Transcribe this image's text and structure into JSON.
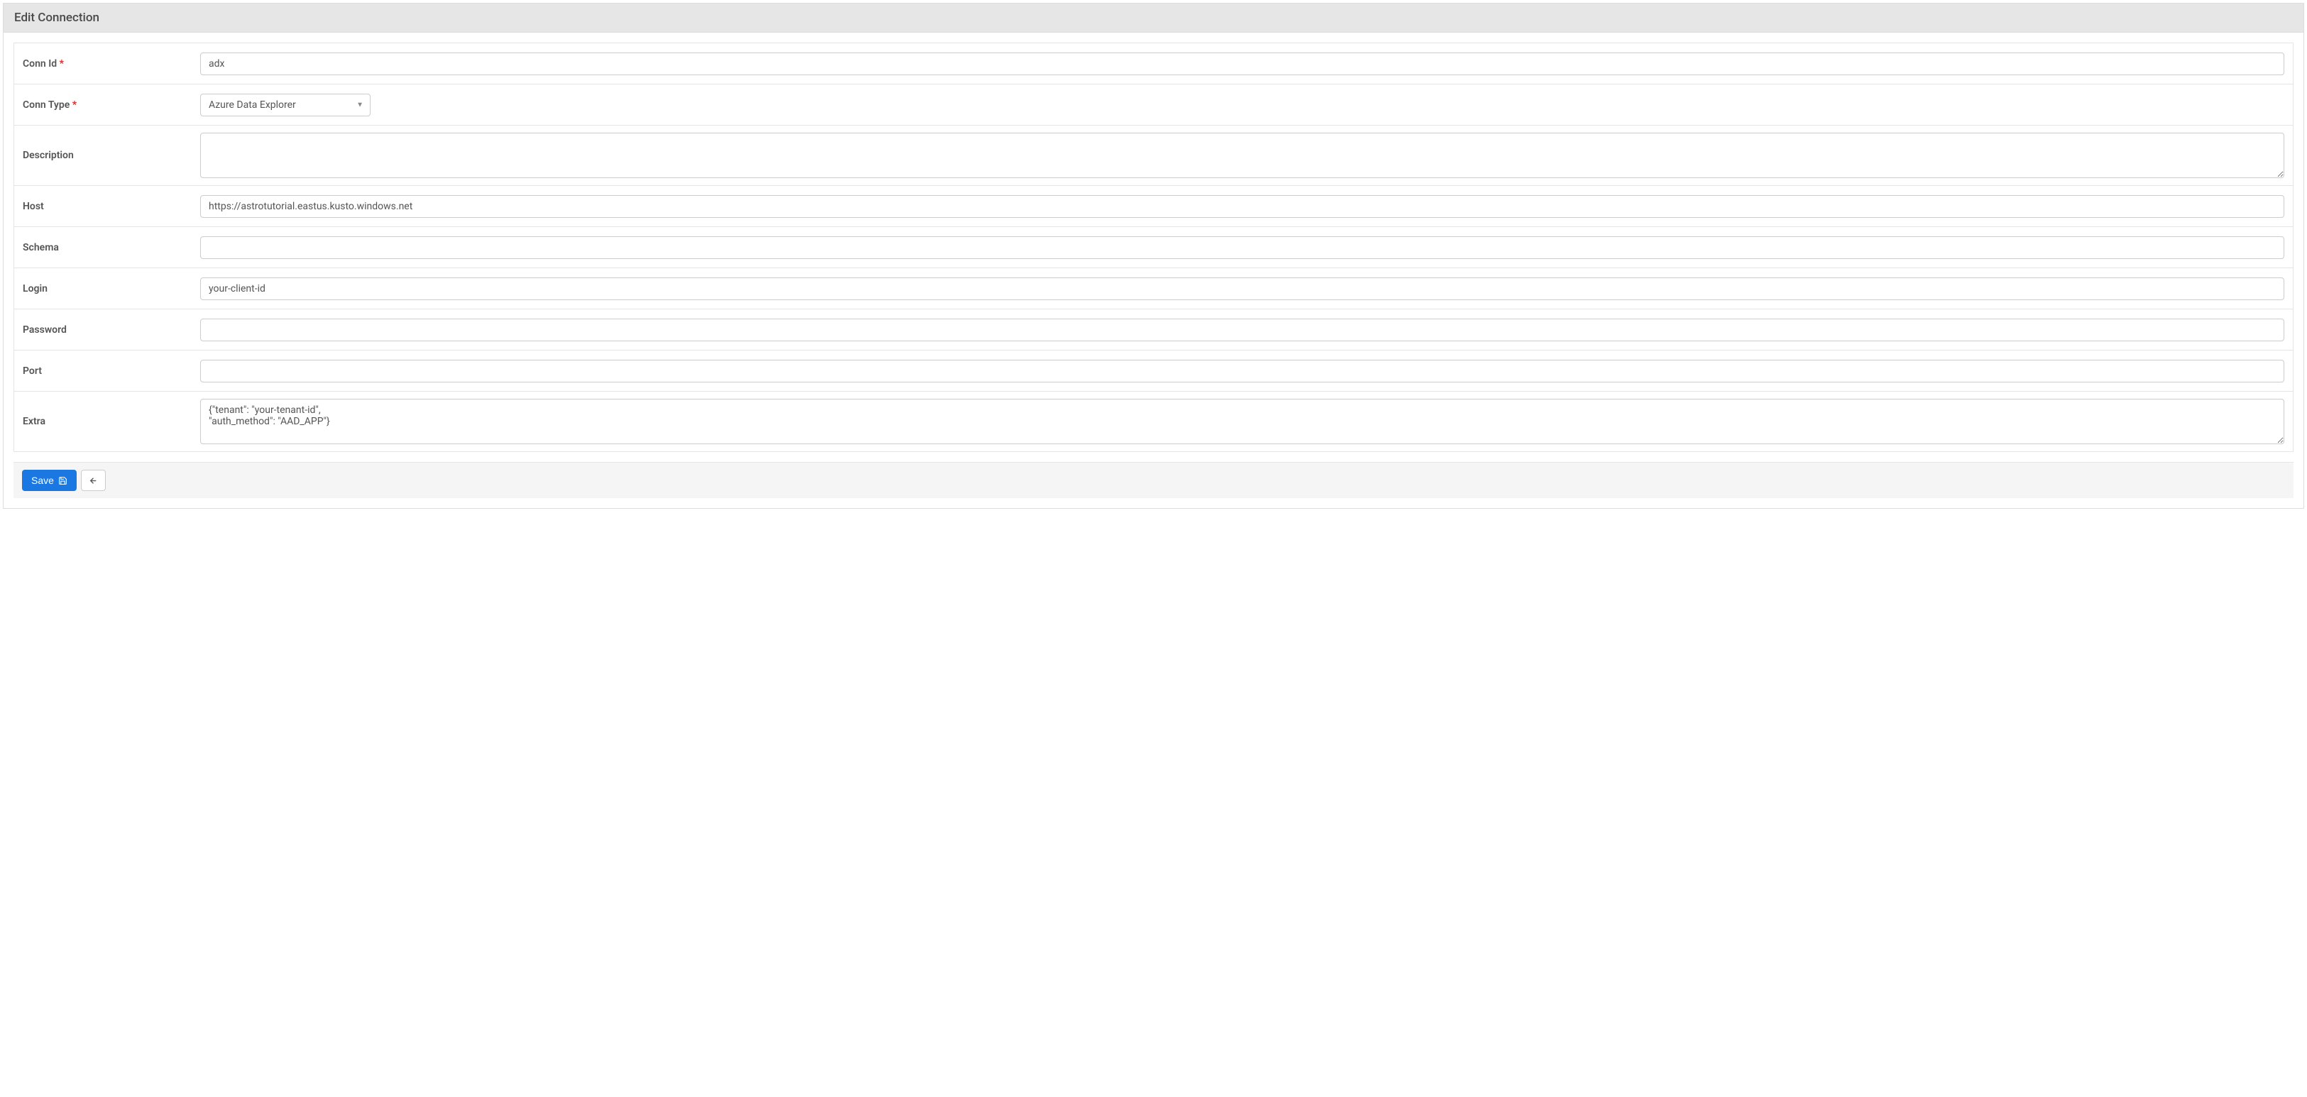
{
  "header": {
    "title": "Edit Connection"
  },
  "form": {
    "conn_id": {
      "label": "Conn Id",
      "required": true,
      "value": "adx"
    },
    "conn_type": {
      "label": "Conn Type",
      "required": true,
      "value": "Azure Data Explorer"
    },
    "description": {
      "label": "Description",
      "required": false,
      "value": ""
    },
    "host": {
      "label": "Host",
      "required": false,
      "value": "https://astrotutorial.eastus.kusto.windows.net"
    },
    "schema": {
      "label": "Schema",
      "required": false,
      "value": ""
    },
    "login": {
      "label": "Login",
      "required": false,
      "value": "your-client-id"
    },
    "password": {
      "label": "Password",
      "required": false,
      "value": ""
    },
    "port": {
      "label": "Port",
      "required": false,
      "value": ""
    },
    "extra": {
      "label": "Extra",
      "required": false,
      "value": "{\"tenant\": \"your-tenant-id\",\n\"auth_method\": \"AAD_APP\"}"
    }
  },
  "footer": {
    "save_label": "Save"
  }
}
